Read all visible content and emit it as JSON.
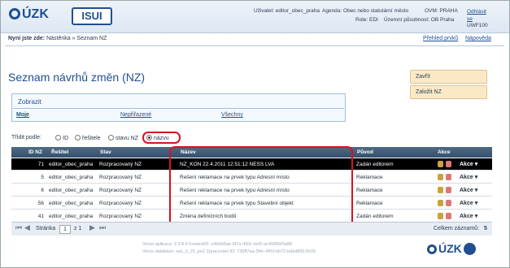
{
  "header": {
    "logo_cuzk": "ÚZK",
    "logo_isui": "ISUI",
    "user_label": "Uživatel: editor_obec_praha",
    "agenda_label": "Agenda: Obec nebo statutární město",
    "ovm_label": "OVM: PRAHA",
    "role_label": "Role: EDI",
    "scope_label": "Územní působnost: OB Praha",
    "logout_label": "Odhlásit se",
    "logout_code": "UWF100"
  },
  "breadcrumb": {
    "prefix": "Nyní jste zde:",
    "path": "Nástěnka » Seznam NZ"
  },
  "toplinks": {
    "overview": "Přehled prvků",
    "help": "Nápověda"
  },
  "page": {
    "title": "Seznam návrhů změn (NZ)"
  },
  "side_buttons": {
    "close": "Zavřít",
    "create": "Založit NZ"
  },
  "filter": {
    "title": "Zobrazit",
    "mine": "Moje",
    "unassigned": "Nepřiřazené",
    "all": "Všechny"
  },
  "sort": {
    "label": "Třídit podle:",
    "options": [
      "ID",
      "řešitele",
      "stavu NZ",
      "názvu"
    ],
    "selected": "názvu"
  },
  "table": {
    "headers": [
      "ID NZ",
      "Řešitel",
      "Stav",
      "Název",
      "Původ",
      "Akce"
    ],
    "rows": [
      {
        "id": "71",
        "resitel": "editor_obec_praha",
        "stav": "Rozpracovaný NZ",
        "nazev": "NZ_KON 22.4.2011 12:51:12 NESS LVA",
        "puvod": "Zadán editorem",
        "akce": "Akce",
        "selected": true
      },
      {
        "id": "5",
        "resitel": "editor_obec_praha",
        "stav": "Rozpracovaný NZ",
        "nazev": "Řešení reklamace na prvek typu Adresní místo",
        "puvod": "Reklamace",
        "akce": "Akce",
        "selected": false
      },
      {
        "id": "6",
        "resitel": "editor_obec_praha",
        "stav": "Rozpracovaný NZ",
        "nazev": "Řešení reklamace na prvek typu Adresní místo",
        "puvod": "Reklamace",
        "akce": "Akce",
        "selected": false
      },
      {
        "id": "56",
        "resitel": "editor_obec_praha",
        "stav": "Rozpracovaný NZ",
        "nazev": "Řešení reklamace na prvek typu Stavební objekt",
        "puvod": "Reklamace",
        "akce": "Akce",
        "selected": false
      },
      {
        "id": "41",
        "resitel": "editor_obec_praha",
        "stav": "Rozpracovaný NZ",
        "nazev": "Změna definičních bodů",
        "puvod": "Zadán editorem",
        "akce": "Akce",
        "selected": false
      }
    ]
  },
  "footer": {
    "page_label": "Stránka",
    "page_value": "1",
    "page_of": "z 1",
    "total_label": "Celkem záznamů:",
    "total_value": "5"
  },
  "version": {
    "line1": "Verze aplikace: 2.3.8.9 KontextID: e4b0b5ae-6f7a-430c-bcf0-ac4686bf3a88",
    "line2": "Verze databáze: isui_0_25_pe2 Zpracování ID: 736ff7aa-3f4c-4f03-bb72-bdad8651fc05"
  },
  "bottom_logo": "ÚZK",
  "colors": {
    "brand": "#1f4f90",
    "highlight": "#d4141f",
    "header_bar": "#34506d",
    "side_button": "#fbe9c6"
  }
}
